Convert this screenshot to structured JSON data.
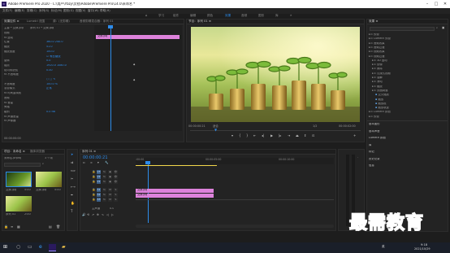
{
  "window": {
    "title": "Adobe Premiere Pro 2020 - C:\\用户\\Ybzy\\文档\\Adobe\\Premiere Pro\\14.0\\未命名 *",
    "app_icon_label": "Pr"
  },
  "menu": [
    "文件(F)",
    "编辑(E)",
    "剪辑(C)",
    "序列(S)",
    "标记(M)",
    "图形(G)",
    "视图(V)",
    "窗口(W)",
    "帮助(H)"
  ],
  "workspaces": [
    "学习",
    "组件",
    "编辑",
    "颜色",
    "效果",
    "音频",
    "图形",
    "库"
  ],
  "workspace_active_index": 4,
  "effect_controls": {
    "tabs": [
      "效果控件 ≡",
      "Lumetri 范围",
      "源：(无剪辑)",
      "音频剪辑混合器：序列 01"
    ],
    "master_label": "主要 * 交换.jpg",
    "clip_label": "序列 01 * 交换.jpg",
    "rows": [
      {
        "label": "视频",
        "value": ""
      },
      {
        "label": "fx 运动",
        "value": ""
      },
      {
        "label": "位置",
        "value": "360.0   240.0"
      },
      {
        "label": "缩放",
        "value": "51.0"
      },
      {
        "label": "缩放宽度",
        "value": "100.0"
      },
      {
        "label": "",
        "value": "☑ 等比缩放"
      },
      {
        "label": "旋转",
        "value": "0.0"
      },
      {
        "label": "锚点",
        "value": "1920.0   1080.0"
      },
      {
        "label": "防闪烁滤镜",
        "value": "0.00"
      },
      {
        "label": "fx 不透明度",
        "value": ""
      },
      {
        "label": "",
        "value": "○ □ ✎"
      },
      {
        "label": "不透明度",
        "value": "100.0 %"
      },
      {
        "label": "混合模式",
        "value": "正常"
      },
      {
        "label": "fx 时间重映射",
        "value": ""
      },
      {
        "label": "音频",
        "value": ""
      },
      {
        "label": "fx 音量",
        "value": ""
      },
      {
        "label": "旁路",
        "value": ""
      },
      {
        "label": "级别",
        "value": "0.0 dB"
      },
      {
        "label": "fx 声道音量",
        "value": ""
      },
      {
        "label": "fx 声像器",
        "value": ""
      }
    ],
    "clip_bar_label": "交换.jpg",
    "time": "00:00:00:00"
  },
  "program_monitor": {
    "tab": "节目：序列 01 ≡",
    "timecode": "00:00:00:21",
    "fit": "适合",
    "fraction": "1/2",
    "duration": "00:00:02:00"
  },
  "project": {
    "tabs": [
      "项目：未命名 ≡",
      "媒体浏览器"
    ],
    "file": "未命名.prproj",
    "count": "3 个项",
    "items": [
      {
        "name": "交换.jpg",
        "duration": "5:00"
      },
      {
        "name": "交换.jpg",
        "duration": "5:00"
      },
      {
        "name": "序列 01",
        "duration": "2:00"
      }
    ]
  },
  "timeline": {
    "tab": "序列 01 ≡",
    "timecode": "00:00:00:21",
    "ruler": [
      ":00:00",
      "00:00:05:00",
      "00:00:10:00"
    ],
    "video_tracks": [
      "V3",
      "V2",
      "V1"
    ],
    "audio_tracks": [
      "A1",
      "A2",
      "A3"
    ],
    "master_label": "主声道",
    "master_value": "0.0",
    "clips": [
      {
        "track": "V1",
        "label": "交换.jpg"
      },
      {
        "track": "V1",
        "label": "交换.jpg"
      }
    ]
  },
  "effects_panel": {
    "tab": "效果 ≡",
    "tree": [
      {
        "label": "预设",
        "level": 0,
        "kind": "folder"
      },
      {
        "label": "Lumetri 预设",
        "level": 0,
        "kind": "folder"
      },
      {
        "label": "音频效果",
        "level": 0,
        "kind": "folder"
      },
      {
        "label": "音频过渡",
        "level": 0,
        "kind": "folder"
      },
      {
        "label": "视频效果",
        "level": 0,
        "kind": "folder"
      },
      {
        "label": "视频过渡",
        "level": 0,
        "kind": "folder"
      },
      {
        "label": "3D 运动",
        "level": 1,
        "kind": "folder"
      },
      {
        "label": "划像",
        "level": 1,
        "kind": "folder"
      },
      {
        "label": "擦除",
        "level": 1,
        "kind": "folder"
      },
      {
        "label": "沉浸式视频",
        "level": 1,
        "kind": "folder"
      },
      {
        "label": "溶解",
        "level": 1,
        "kind": "folder"
      },
      {
        "label": "滑动",
        "level": 1,
        "kind": "folder"
      },
      {
        "label": "缩放",
        "level": 1,
        "kind": "folder"
      },
      {
        "label": "页面剥落",
        "level": 1,
        "kind": "folder"
      },
      {
        "label": "交叉缩放",
        "level": 2,
        "kind": "item"
      },
      {
        "label": "缩放",
        "level": 2,
        "kind": "item"
      },
      {
        "label": "缩放框",
        "level": 2,
        "kind": "item"
      },
      {
        "label": "缩放轨迹",
        "level": 2,
        "kind": "item"
      },
      {
        "label": "Lumetri 颜色",
        "level": 0,
        "kind": "folder"
      },
      {
        "label": "预设",
        "level": 0,
        "kind": "folder"
      }
    ],
    "sections": [
      "基本图形",
      "基本声音",
      "Lumetri 颜色",
      "库",
      "标记",
      "历史记录",
      "信息"
    ]
  },
  "taskbar": {
    "time": "9:18",
    "date": "2021/10/29",
    "lang": "英"
  },
  "watermark": "最需教育",
  "colors": {
    "accent_blue": "#2d8ceb",
    "clip_pink": "#dd82db",
    "panel_bg": "#232323"
  }
}
